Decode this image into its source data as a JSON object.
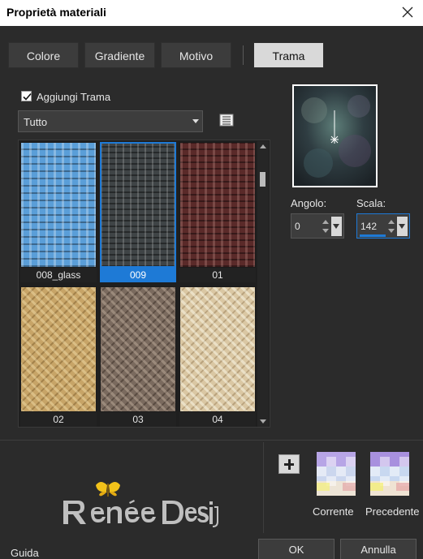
{
  "window": {
    "title": "Proprietà materiali"
  },
  "tabs": [
    {
      "label": "Colore",
      "active": false
    },
    {
      "label": "Gradiente",
      "active": false
    },
    {
      "label": "Motivo",
      "active": false
    },
    {
      "label": "Trama",
      "active": true
    }
  ],
  "texture": {
    "add_label": "Aggiungi Trama",
    "add_checked": true,
    "filter_value": "Tutto",
    "items": [
      {
        "label": "008_glass",
        "color": "#5a9ed8",
        "selected": false
      },
      {
        "label": "009",
        "color": "#3f4446",
        "selected": true
      },
      {
        "label": "01",
        "color": "#5a2a29",
        "selected": false
      },
      {
        "label": "02",
        "color": "#c7a467",
        "selected": false
      },
      {
        "label": "03",
        "color": "#7a6a5e",
        "selected": false
      },
      {
        "label": "04",
        "color": "#dac7a3",
        "selected": false
      }
    ]
  },
  "controls": {
    "angle_label": "Angolo:",
    "angle_value": "0",
    "scale_label": "Scala:",
    "scale_value": "142"
  },
  "swatches": {
    "current_label": "Corrente",
    "previous_label": "Precedente"
  },
  "logo": {
    "text": "Renée Design"
  },
  "footer": {
    "help_label": "Guida",
    "ok_label": "OK",
    "cancel_label": "Annulla"
  },
  "colors": {
    "accent": "#1e7ad6",
    "background": "#2b2b2b"
  }
}
